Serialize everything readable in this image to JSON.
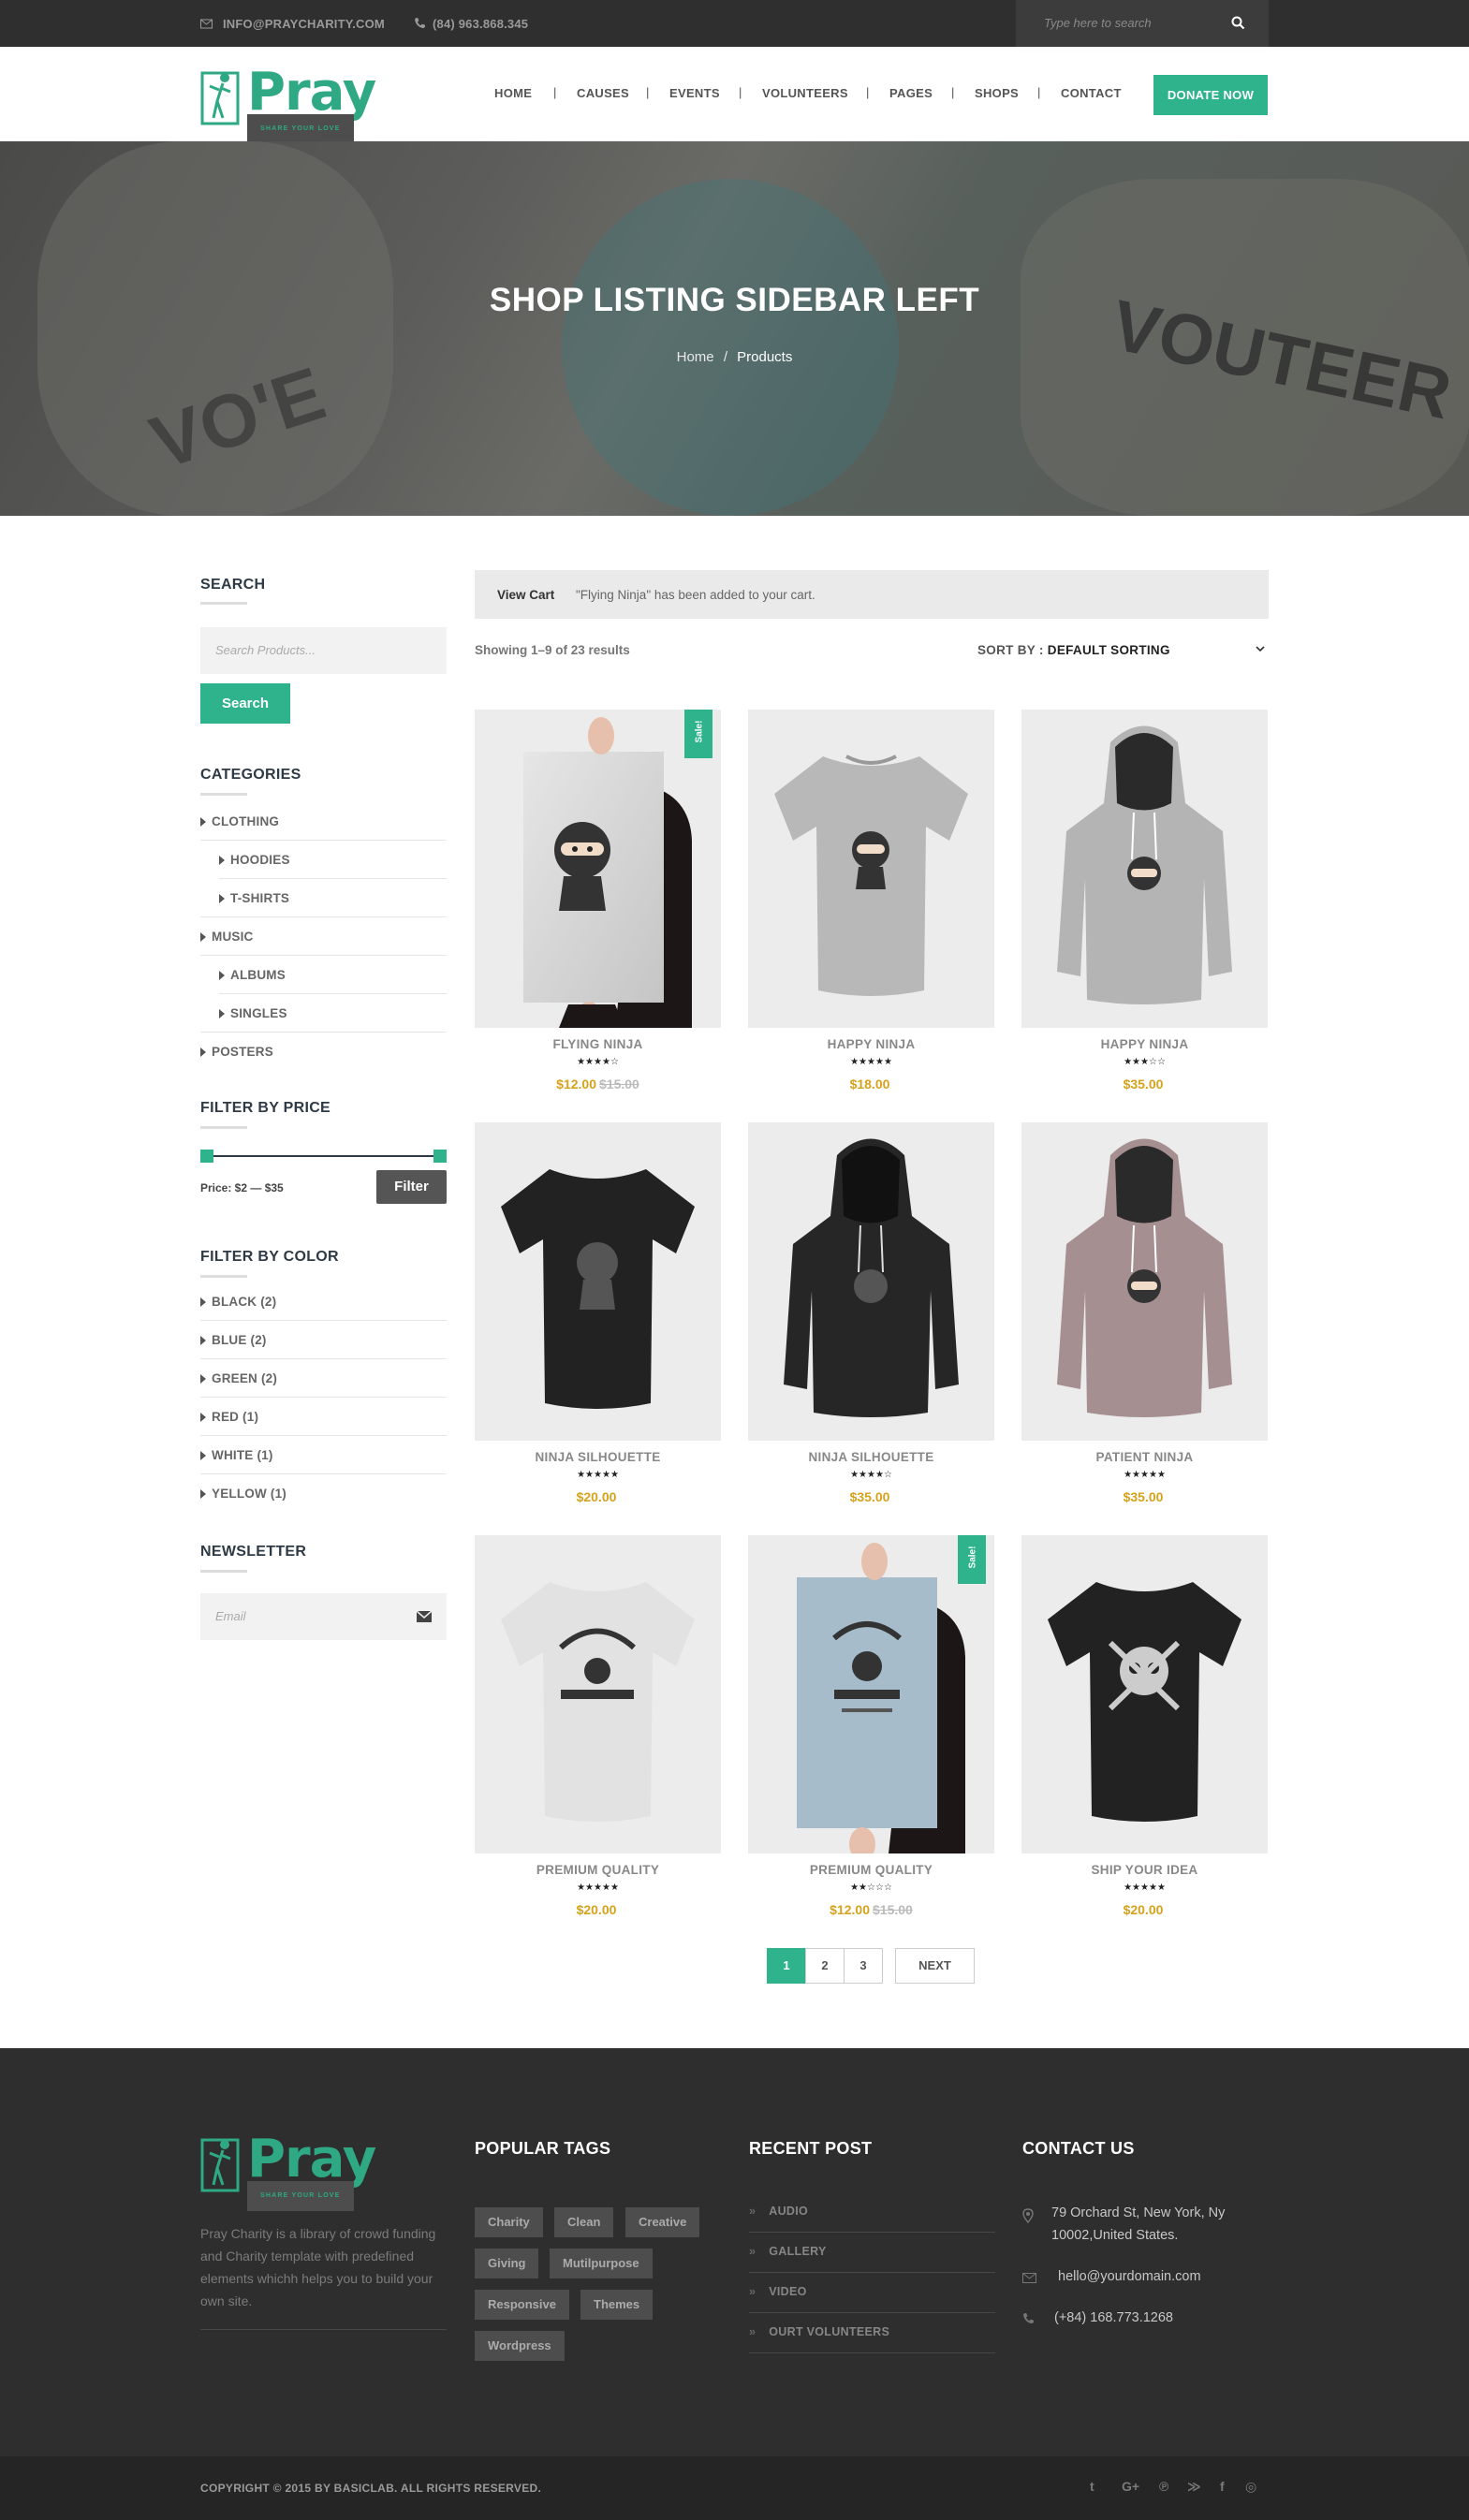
{
  "topbar": {
    "email": "INFO@PRAYCHARITY.COM",
    "phone": "(84) 963.868.345",
    "search_placeholder": "Type here to search"
  },
  "header": {
    "logo_text": "Pray",
    "logo_tagline": "SHARE YOUR LOVE",
    "nav": [
      "HOME",
      "CAUSES",
      "EVENTS",
      "VOLUNTEERS",
      "PAGES",
      "SHOPS",
      "CONTACT"
    ],
    "donate_label": "DONATE NOW"
  },
  "hero": {
    "title": "SHOP LISTING SIDEBAR LEFT",
    "breadcrumb_home": "Home",
    "breadcrumb_sep": "/",
    "breadcrumb_current": "Products",
    "bg_text_right": "VOUTEER",
    "bg_text_left": "VO'E"
  },
  "sidebar": {
    "search_title": "SEARCH",
    "search_placeholder": "Search Products...",
    "search_button": "Search",
    "categories_title": "CATEGORIES",
    "categories": [
      "CLOTHING",
      "HOODIES",
      "T-SHIRTS",
      "MUSIC",
      "ALBUMS",
      "SINGLES",
      "POSTERS"
    ],
    "price_title": "FILTER BY PRICE",
    "price_text": "Price: $2 — $35",
    "filter_button": "Filter",
    "color_title": "FILTER BY COLOR",
    "colors": [
      "BLACK (2)",
      "BLUE (2)",
      "GREEN (2)",
      "RED (1)",
      "WHITE (1)",
      "YELLOW (1)"
    ],
    "newsletter_title": "NEWSLETTER",
    "newsletter_placeholder": "Email"
  },
  "shop": {
    "notice_view_cart": "View Cart",
    "notice_message": "\"Flying Ninja\" has been added to your cart.",
    "showing": "Showing 1–9 of 23 results",
    "sort_label": "SORT BY :",
    "sort_value": "DEFAULT SORTING",
    "sale_label": "Sale!",
    "products": [
      {
        "name": "FLYING NINJA",
        "stars": "★★★★☆",
        "price": "$12.00",
        "old_price": "$15.00",
        "sale": true
      },
      {
        "name": "HAPPY NINJA",
        "stars": "★★★★★",
        "price": "$18.00",
        "old_price": "",
        "sale": false
      },
      {
        "name": "HAPPY NINJA",
        "stars": "★★★☆☆",
        "price": "$35.00",
        "old_price": "",
        "sale": false
      },
      {
        "name": "NINJA SILHOUETTE",
        "stars": "★★★★★",
        "price": "$20.00",
        "old_price": "",
        "sale": false
      },
      {
        "name": "NINJA SILHOUETTE",
        "stars": "★★★★☆",
        "price": "$35.00",
        "old_price": "",
        "sale": false
      },
      {
        "name": "PATIENT NINJA",
        "stars": "★★★★★",
        "price": "$35.00",
        "old_price": "",
        "sale": false
      },
      {
        "name": "PREMIUM QUALITY",
        "stars": "★★★★★",
        "price": "$20.00",
        "old_price": "",
        "sale": false
      },
      {
        "name": "PREMIUM QUALITY",
        "stars": "★★☆☆☆",
        "price": "$12.00",
        "old_price": "$15.00",
        "sale": true
      },
      {
        "name": "SHIP YOUR IDEA",
        "stars": "★★★★★",
        "price": "$20.00",
        "old_price": "",
        "sale": false
      }
    ],
    "pagination": [
      "1",
      "2",
      "3"
    ],
    "next_label": "NEXT"
  },
  "footer": {
    "logo_text": "Pray",
    "logo_tagline": "SHARE YOUR LOVE",
    "description": "Pray Charity is a library of crowd funding and Charity template with predefined elements whichh helps you to build your own site.",
    "tags_title": "POPULAR TAGS",
    "tags": [
      "Charity",
      "Clean",
      "Creative",
      "Giving",
      "Mutilpurpose",
      "Responsive",
      "Themes",
      "Wordpress"
    ],
    "recent_title": "RECENT POST",
    "recent": [
      "AUDIO",
      "GALLERY",
      "VIDEO",
      "OURT VOLUNTEERS"
    ],
    "contact_title": "CONTACT US",
    "address_line1": "79 Orchard St, New York, Ny",
    "address_line2": "10002,United States.",
    "email": "hello@yourdomain.com",
    "phone": "(+84) 168.773.1268",
    "copyright": "COPYRIGHT © 2015 BY BASICLAB. ALL RIGHTS RESERVED."
  },
  "colors": {
    "accent": "#2fb38c",
    "price": "#d5a21b",
    "dark": "#2e2e2e"
  }
}
